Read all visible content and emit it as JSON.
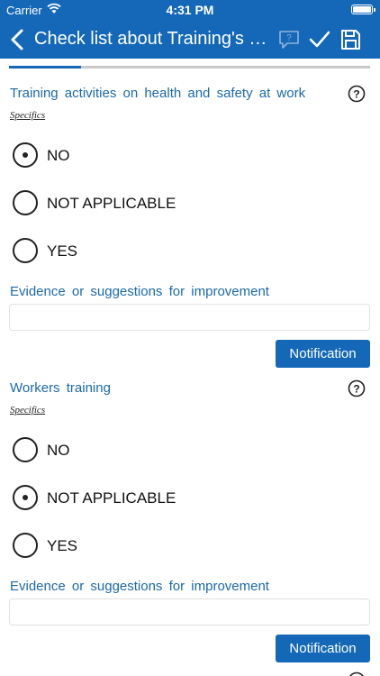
{
  "status_bar": {
    "carrier": "Carrier",
    "time": "4:31 PM"
  },
  "nav": {
    "title": "Check list about Training's p..."
  },
  "progress": {
    "fraction": 0.2
  },
  "questions": [
    {
      "title": "Training activities on health and safety at work",
      "specifics": "Specifics",
      "options": [
        {
          "label": "NO",
          "selected": true
        },
        {
          "label": "NOT APPLICABLE",
          "selected": false
        },
        {
          "label": "YES",
          "selected": false
        }
      ],
      "evidence_label": "Evidence or suggestions for improvement",
      "evidence_value": "",
      "notification_label": "Notification"
    },
    {
      "title": "Workers training",
      "specifics": "Specifics",
      "options": [
        {
          "label": "NO",
          "selected": false
        },
        {
          "label": "NOT APPLICABLE",
          "selected": true
        },
        {
          "label": "YES",
          "selected": false
        }
      ],
      "evidence_label": "Evidence or suggestions for improvement",
      "evidence_value": "",
      "notification_label": "Notification"
    }
  ],
  "colors": {
    "header": "#1568b8",
    "accent_text": "#1a6aab",
    "progress_track": "#c8c8c8"
  }
}
